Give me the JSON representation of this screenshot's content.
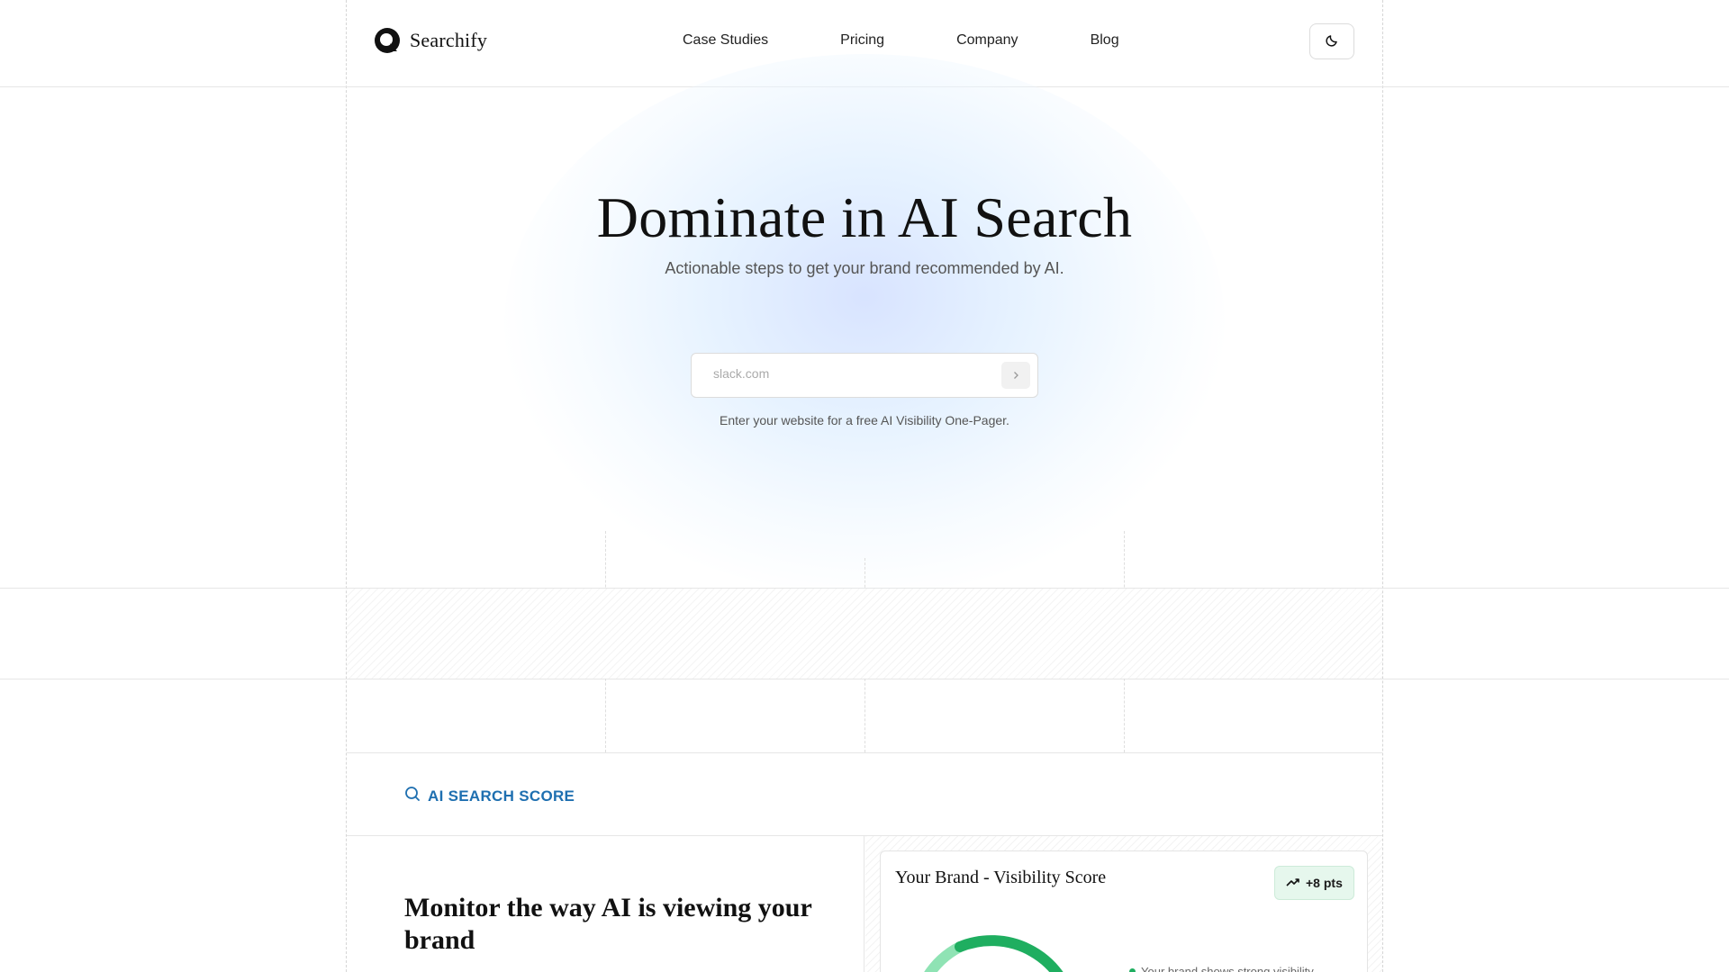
{
  "brand": {
    "name": "Searchify",
    "logo_icon": "searchify-logo-icon"
  },
  "nav": {
    "items": [
      {
        "label": "Case Studies"
      },
      {
        "label": "Pricing"
      },
      {
        "label": "Company"
      },
      {
        "label": "Blog"
      }
    ],
    "theme_toggle_icon": "moon-icon"
  },
  "hero": {
    "title": "Dominate in AI Search",
    "subtitle": "Actionable steps to get your brand recommended by AI.",
    "input_placeholder": "slack.com",
    "input_value": "",
    "submit_icon": "chevron-right-icon",
    "hint": "Enter your website for a free AI Visibility One-Pager."
  },
  "section": {
    "label_icon": "search-icon",
    "label": "AI SEARCH SCORE",
    "title": "Monitor the way AI is viewing your brand"
  },
  "score_card": {
    "title": "Your Brand - Visibility Score",
    "badge_icon": "trending-up-icon",
    "badge_text": "+8 pts",
    "legend_text": "Your brand shows strong visibility",
    "colors": {
      "accent_green": "#1fae60",
      "light_green": "#8fe3b4",
      "link_blue": "#1e6fb0"
    }
  }
}
